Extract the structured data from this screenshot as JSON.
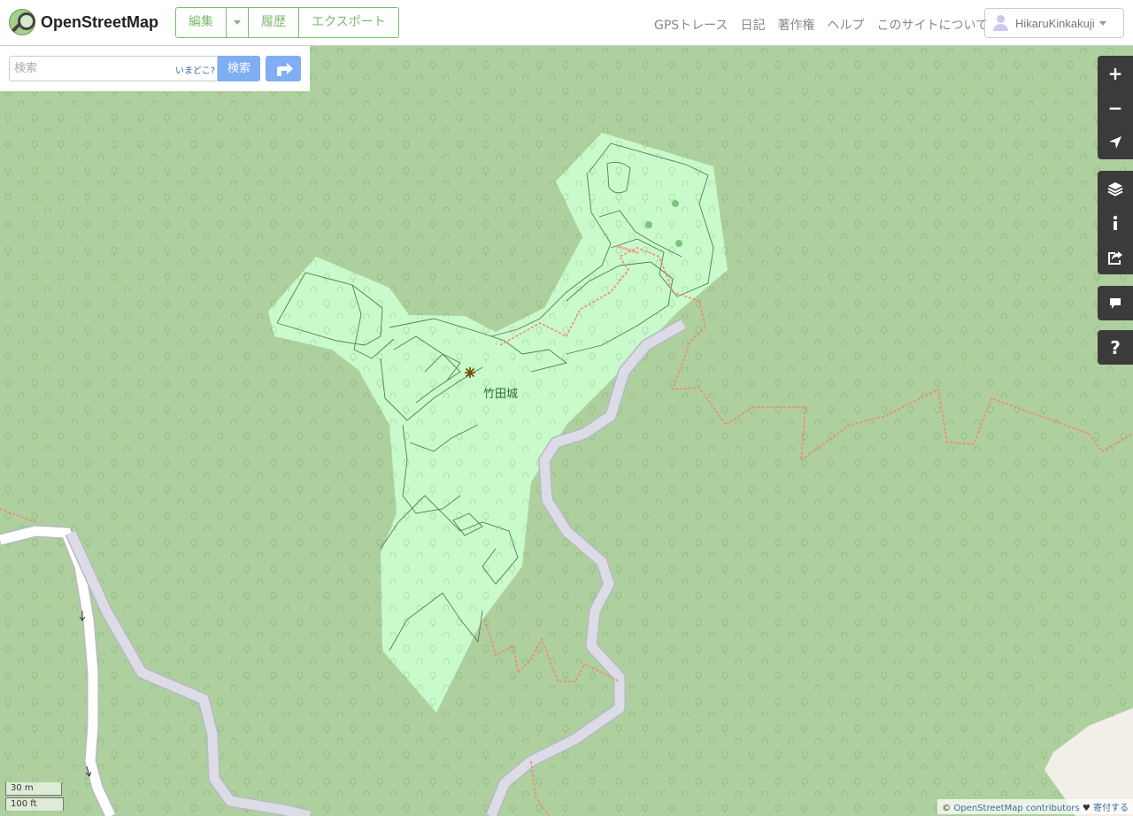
{
  "header": {
    "site_name": "OpenStreetMap",
    "edit_label": "編集",
    "history_label": "履歴",
    "export_label": "エクスポート",
    "nav": [
      "GPSトレース",
      "日記",
      "著作権",
      "ヘルプ",
      "このサイトについて"
    ],
    "username": "HikaruKinkakuji"
  },
  "search": {
    "placeholder": "検索",
    "where_am_i": "いまどこ?",
    "button_label": "検索"
  },
  "map": {
    "place_label": "竹田城",
    "scale_metric": "30 m",
    "scale_imperial": "100 ft",
    "colors": {
      "forest": "#aed09e",
      "park": "#c8facc",
      "road": "#dcdce6",
      "footpath": "#fa8072"
    }
  },
  "controls": {
    "zoom_in": "+",
    "zoom_out": "−",
    "help": "?"
  },
  "attribution": {
    "prefix": "©",
    "link": "OpenStreetMap contributors",
    "heart": "♥",
    "donate": "寄付する"
  }
}
